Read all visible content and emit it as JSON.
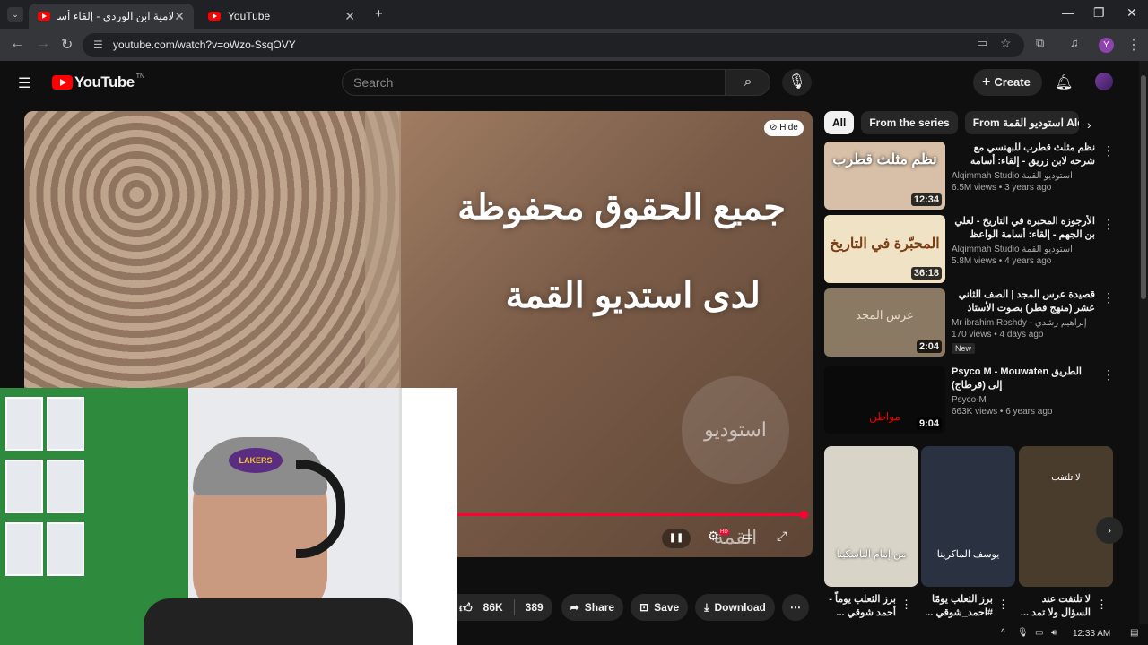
{
  "browser": {
    "tabs": [
      {
        "title": "لامية ابن الوردي - إلقاء أسامة الوا"
      },
      {
        "title": "YouTube"
      }
    ],
    "new_tab": "+",
    "url": "youtube.com/watch?v=oWzo-SsqOVY",
    "profile_initial": "Y"
  },
  "yt": {
    "logo": "YouTube",
    "logo_tn": "TN",
    "search_placeholder": "Search",
    "create_label": "Create"
  },
  "player": {
    "overlay_line1": "جميع الحقوق محفوظة",
    "overlay_line2": "لدى استديو القمة",
    "hide_label": "Hide",
    "watermark": "استوديو القمة",
    "progress_fraction": 1.0,
    "hd_badge": "HD"
  },
  "webcam": {
    "beanie_logo": "LAKERS"
  },
  "actions": {
    "likes": "86K",
    "dislikes": "389",
    "share": "Share",
    "save": "Save",
    "download": "Download"
  },
  "chips": [
    "All",
    "From the series",
    "From استوديو القمة Alqimmah"
  ],
  "recs": [
    {
      "title": "نظم مثلث قطرب للبهنسي مع شرحه لابن زريق - إلقاء: أسامة الواعظ",
      "channel": "Alqimmah Studio استوديو القمة",
      "views": "6.5M views • 3 years ago",
      "duration": "12:34",
      "thumb_text": "نظم مثلث قطرب",
      "thumb_bg": "#d8c0a8"
    },
    {
      "title": "الأرجوزة المحبرة في التاريخ - لعلي بن الجهم - إلقاء: أسامة الواعظ",
      "channel": "Alqimmah Studio استوديو القمة",
      "views": "5.8M views • 4 years ago",
      "duration": "36:18",
      "thumb_text": "المحبّرة في التاريخ",
      "thumb_bg": "#f0e2c4"
    },
    {
      "title": "قصيدة عرس المجد | الصف الثاني عشر (منهج قطر) بصوت الأستاذ إبراهيم رشدي",
      "channel": "Mr ibrahim Roshdy - إبراهيم رشدي",
      "views": "170 views • 4 days ago",
      "duration": "2:04",
      "badge": "New",
      "thumb_text": "عرس المجد",
      "thumb_bg": "#8a7a64"
    },
    {
      "title": "Psyco M - Mouwaten الطريق إلى (قرطاج)",
      "channel": "Psyco-M",
      "views": "663K views • 6 years ago",
      "duration": "9:04",
      "thumb_text": "مواطن",
      "thumb_bg": "#0a0a0a"
    }
  ],
  "shorts": [
    {
      "title": "برز الثعلب يوماً - أحمد شوقي ...",
      "thumb_text": "من إمام الناسكينا",
      "thumb_bg": "#d8d4c8"
    },
    {
      "title": "برز الثعلب يومًا #احمد_شوقي ...",
      "thumb_text": "يوسف الماكرينا",
      "thumb_bg": "#2a3140"
    },
    {
      "title": "لا تلتفت عند السؤال ولا تمد ...",
      "thumb_text": "لا تلتفت",
      "thumb_bg": "#4a3c2c"
    }
  ],
  "clock": "12:33 AM"
}
